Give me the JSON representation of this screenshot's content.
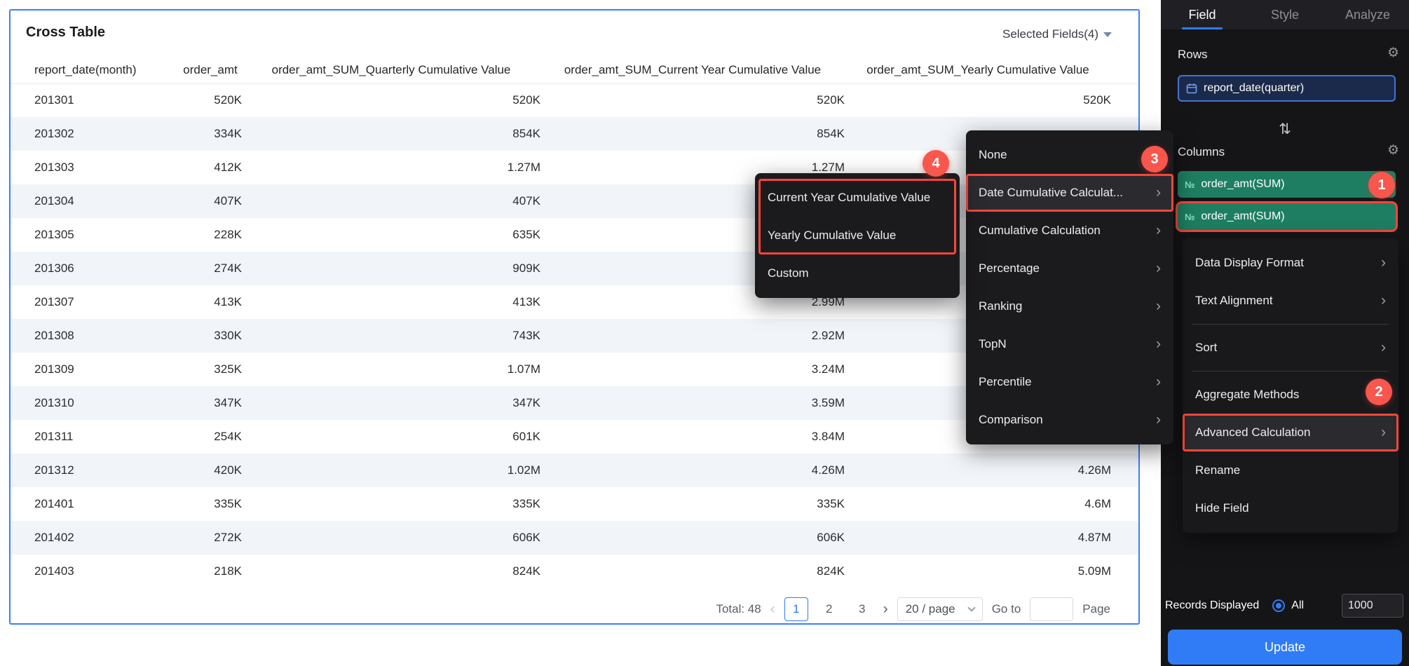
{
  "icons": {
    "chevron_right": "›",
    "chevron_left": "‹",
    "gear": "⚙",
    "swap": "⇅",
    "numeric_field": "№"
  },
  "colors": {
    "accent_blue": "#2F7CF6",
    "panel_border_blue": "#3D7FFF",
    "highlight_red": "#F8473A",
    "badge_red": "#F9564D",
    "measure_green": "#1E7E61",
    "dimension_blue": "#4673D6",
    "alt_row": "#F1F5FA",
    "sidebar_bg": "#151518",
    "menu_bg": "#1B1B1E"
  },
  "panel": {
    "title": "Cross Table",
    "selected_fields_label": "Selected Fields(4)"
  },
  "table": {
    "columns": [
      "report_date(month)",
      "order_amt",
      "order_amt_SUM_Quarterly Cumulative Value",
      "order_amt_SUM_Current Year Cumulative Value",
      "order_amt_SUM_Yearly Cumulative Value"
    ],
    "rows": [
      [
        "201301",
        "520K",
        "520K",
        "520K",
        "520K"
      ],
      [
        "201302",
        "334K",
        "854K",
        "854K",
        ""
      ],
      [
        "201303",
        "412K",
        "1.27M",
        "1.27M",
        ""
      ],
      [
        "201304",
        "407K",
        "407K",
        "",
        ""
      ],
      [
        "201305",
        "228K",
        "635K",
        "",
        ""
      ],
      [
        "201306",
        "274K",
        "909K",
        "",
        ""
      ],
      [
        "201307",
        "413K",
        "413K",
        "2.99M",
        ""
      ],
      [
        "201308",
        "330K",
        "743K",
        "2.92M",
        ""
      ],
      [
        "201309",
        "325K",
        "1.07M",
        "3.24M",
        ""
      ],
      [
        "201310",
        "347K",
        "347K",
        "3.59M",
        ""
      ],
      [
        "201311",
        "254K",
        "601K",
        "3.84M",
        ""
      ],
      [
        "201312",
        "420K",
        "1.02M",
        "4.26M",
        "4.26M"
      ],
      [
        "201401",
        "335K",
        "335K",
        "335K",
        "4.6M"
      ],
      [
        "201402",
        "272K",
        "606K",
        "606K",
        "4.87M"
      ],
      [
        "201403",
        "218K",
        "824K",
        "824K",
        "5.09M"
      ]
    ]
  },
  "pagination": {
    "total_label": "Total: 48",
    "pages": [
      "1",
      "2",
      "3"
    ],
    "active_page": "1",
    "page_size_label": "20 / page",
    "goto_label": "Go to",
    "goto_value": "",
    "page_label": "Page"
  },
  "context_menu": {
    "items": [
      {
        "label": "None",
        "submenu": false,
        "highlighted": false
      },
      {
        "label": "Date Cumulative Calculat...",
        "submenu": true,
        "highlighted": true
      },
      {
        "label": "Cumulative Calculation",
        "submenu": true,
        "highlighted": false
      },
      {
        "label": "Percentage",
        "submenu": true,
        "highlighted": false
      },
      {
        "label": "Ranking",
        "submenu": true,
        "highlighted": false
      },
      {
        "label": "TopN",
        "submenu": true,
        "highlighted": false
      },
      {
        "label": "Percentile",
        "submenu": true,
        "highlighted": false
      },
      {
        "label": "Comparison",
        "submenu": true,
        "highlighted": false
      }
    ]
  },
  "date_submenu": {
    "items": [
      {
        "label": "Current Year Cumulative Value",
        "submenu": false,
        "highlighted": false
      },
      {
        "label": "Yearly Cumulative Value",
        "submenu": false,
        "highlighted": false
      },
      {
        "label": "Custom",
        "submenu": false,
        "highlighted": false
      }
    ]
  },
  "sidebar": {
    "tabs": [
      {
        "label": "Field",
        "active": true
      },
      {
        "label": "Style",
        "active": false
      },
      {
        "label": "Analyze",
        "active": false
      }
    ],
    "rows_section": {
      "label": "Rows",
      "field_label": "report_date(quarter)"
    },
    "columns_section": {
      "label": "Columns",
      "fields": [
        {
          "label": "order_amt(SUM)",
          "highlighted": false
        },
        {
          "label": "order_amt(SUM)",
          "highlighted": true
        }
      ]
    },
    "field_menu": {
      "items": [
        {
          "label": "Data Display Format",
          "submenu": true,
          "highlighted": false,
          "sep_before": false
        },
        {
          "label": "Text Alignment",
          "submenu": true,
          "highlighted": false,
          "sep_before": false
        },
        {
          "label": "Sort",
          "submenu": true,
          "highlighted": false,
          "sep_before": true
        },
        {
          "label": "Aggregate Methods",
          "submenu": false,
          "highlighted": false,
          "sep_before": true
        },
        {
          "label": "Advanced Calculation",
          "submenu": true,
          "highlighted": true,
          "sep_before": false
        },
        {
          "label": "Rename",
          "submenu": false,
          "highlighted": false,
          "sep_before": false
        },
        {
          "label": "Hide Field",
          "submenu": false,
          "highlighted": false,
          "sep_before": false
        }
      ]
    },
    "records": {
      "label": "Records Displayed",
      "option_label": "All",
      "value": "1000"
    },
    "update_label": "Update"
  },
  "badges": {
    "one": "1",
    "two": "2",
    "three": "3",
    "four": "4"
  }
}
